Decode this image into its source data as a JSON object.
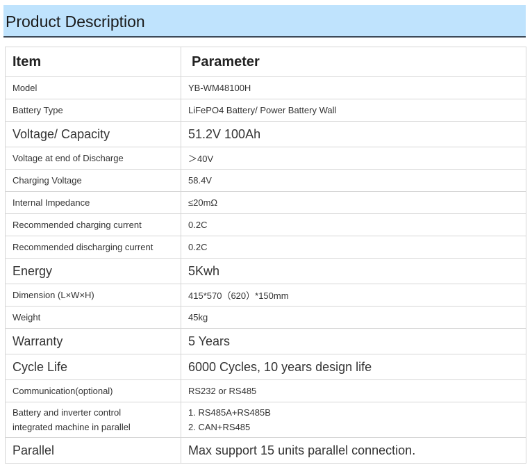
{
  "header": {
    "title": "Product Description"
  },
  "table": {
    "headers": [
      "Item",
      "Parameter"
    ],
    "rows": [
      {
        "size": "small",
        "item": "Model",
        "value": "YB-WM48100H"
      },
      {
        "size": "small",
        "item": "Battery Type",
        "value": "LiFePO4 Battery/ Power Battery Wall"
      },
      {
        "size": "large",
        "item": "Voltage/ Capacity",
        "value": "51.2V 100Ah"
      },
      {
        "size": "small",
        "item": "Voltage at end of Discharge",
        "value": "＞40V"
      },
      {
        "size": "small",
        "item": "Charging Voltage",
        "value": "58.4V"
      },
      {
        "size": "small",
        "item": "Internal Impedance",
        "value": "≤20mΩ"
      },
      {
        "size": "small",
        "item": "Recommended charging current",
        "value": "0.2C"
      },
      {
        "size": "small",
        "item": "Recommended discharging current",
        "value": "0.2C"
      },
      {
        "size": "large",
        "item": "Energy",
        "value": "5Kwh"
      },
      {
        "size": "small",
        "item": "Dimension (L×W×H)",
        "value": "415*570（620）*150mm"
      },
      {
        "size": "small",
        "item": "Weight",
        "value": "45kg"
      },
      {
        "size": "large",
        "item": "Warranty",
        "value": "5 Years"
      },
      {
        "size": "large",
        "item": "Cycle Life",
        "value": "6000 Cycles, 10 years design life"
      },
      {
        "size": "small",
        "item": "Communication(optional)",
        "value": "RS232 or RS485"
      },
      {
        "size": "multi",
        "item_lines": [
          "Battery and inverter control",
          "integrated machine in parallel"
        ],
        "value_lines": [
          "1. RS485A+RS485B",
          "2. CAN+RS485"
        ]
      },
      {
        "size": "large",
        "item": "Parallel",
        "value": "Max support 15 units parallel connection."
      }
    ]
  }
}
